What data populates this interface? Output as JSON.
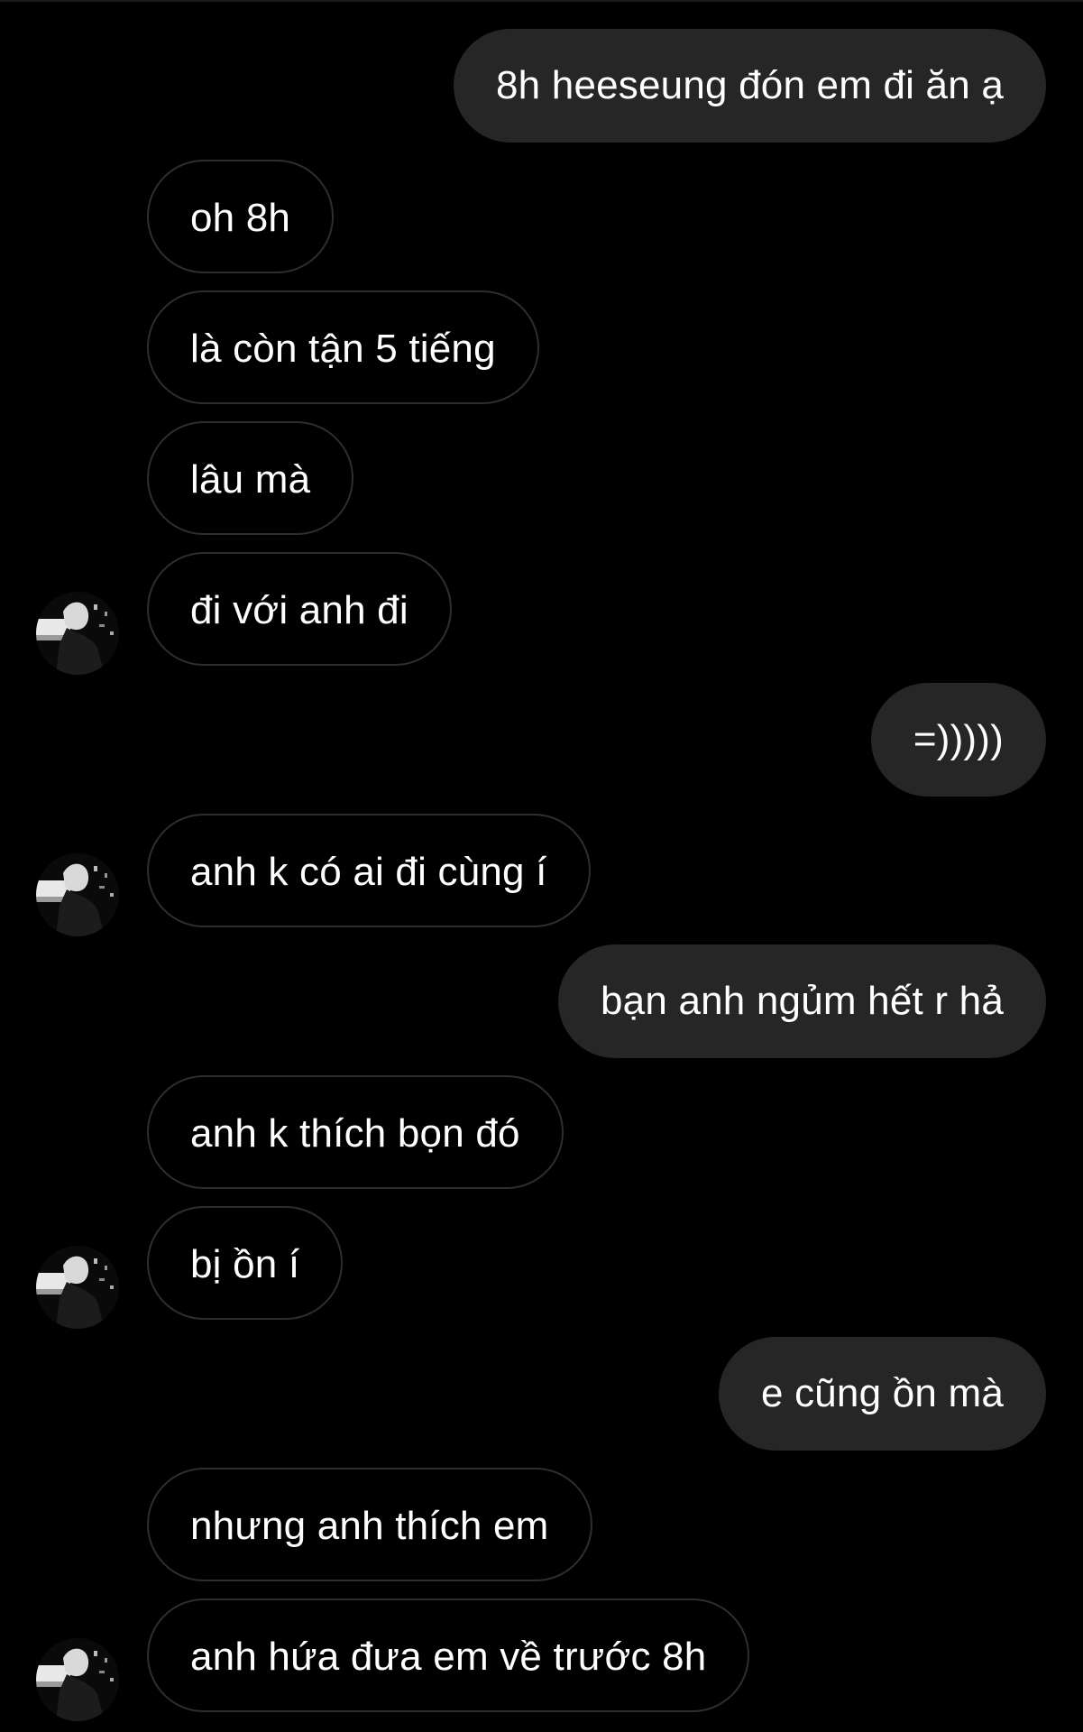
{
  "conversation": {
    "messages": [
      {
        "side": "sent",
        "text": "8h heeseung đón em đi ăn ạ",
        "avatar": false
      },
      {
        "side": "received",
        "text": "oh 8h",
        "avatar": false
      },
      {
        "side": "received",
        "text": "là còn tận 5 tiếng",
        "avatar": false
      },
      {
        "side": "received",
        "text": "lâu mà",
        "avatar": false
      },
      {
        "side": "received",
        "text": "đi với anh đi",
        "avatar": true
      },
      {
        "side": "sent",
        "text": "=)))))",
        "avatar": false
      },
      {
        "side": "received",
        "text": "anh k có ai đi cùng í",
        "avatar": true
      },
      {
        "side": "sent",
        "text": "bạn anh ngủm hết r hả",
        "avatar": false
      },
      {
        "side": "received",
        "text": "anh k thích bọn đó",
        "avatar": false
      },
      {
        "side": "received",
        "text": "bị ồn í",
        "avatar": true
      },
      {
        "side": "sent",
        "text": "e cũng ồn mà",
        "avatar": false
      },
      {
        "side": "received",
        "text": "nhưng anh thích em",
        "avatar": false
      },
      {
        "side": "received",
        "text": "anh hứa đưa em về trước 8h",
        "avatar": true
      }
    ]
  },
  "colors": {
    "background": "#000000",
    "sent_bubble": "#262626",
    "received_border": "#2e2e2e",
    "text": "#ffffff"
  },
  "icons": {
    "avatar": "contact-photo-icon"
  }
}
